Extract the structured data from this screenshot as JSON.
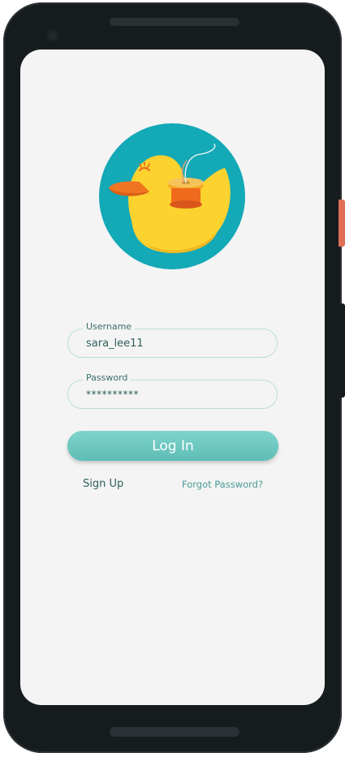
{
  "form": {
    "username_label": "Username",
    "username_value": "sara_lee11",
    "password_label": "Password",
    "password_value": "**********",
    "login_label": "Log In",
    "signup_label": "Sign Up",
    "forgot_label": "Forgot Password?"
  },
  "logo": {
    "icon": "duck-with-spool-logo"
  },
  "colors": {
    "accent": "#6ccac3",
    "logo_background": "#13a9b6",
    "duck_yellow": "#fcd22f",
    "beak_orange": "#f07522",
    "text_teal": "#2f5f5c",
    "screen_background": "#f4f4f4",
    "phone_frame": "#161b1e"
  }
}
